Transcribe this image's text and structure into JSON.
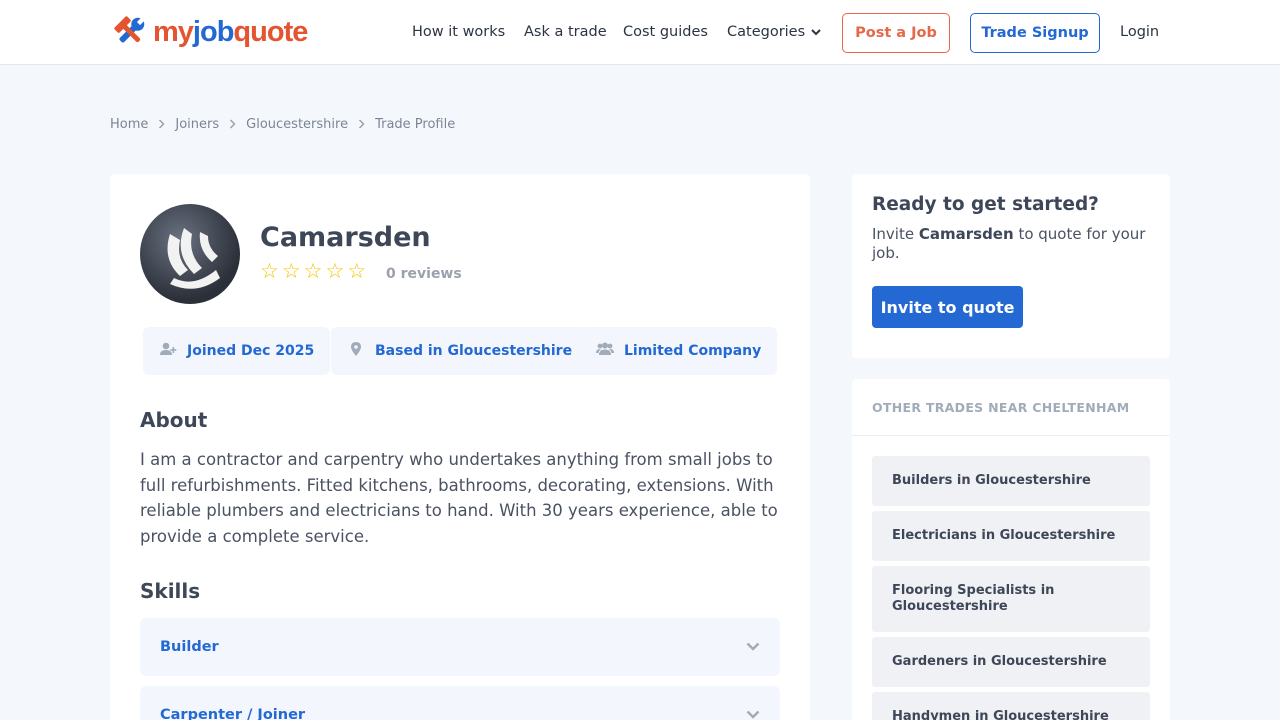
{
  "brand": {
    "logo_part1": "my",
    "logo_part2": "job",
    "logo_part3": "quote"
  },
  "nav": {
    "how_it_works": "How it works",
    "ask_a_trade": "Ask a trade",
    "cost_guides": "Cost guides",
    "categories": "Categories",
    "post_job": "Post a Job",
    "trade_signup": "Trade Signup",
    "login": "Login"
  },
  "breadcrumb": [
    "Home",
    "Joiners",
    "Gloucestershire",
    "Trade Profile"
  ],
  "profile": {
    "name": "Camarsden",
    "rating": 0,
    "rating_max": 5,
    "reviews": "0 reviews",
    "chips": {
      "joined": "Joined Dec 2025",
      "based": "Based in Gloucestershire",
      "company": "Limited Company"
    }
  },
  "about": {
    "title": "About",
    "text": "I am a contractor and carpentry who undertakes anything from small jobs to full refurbishments. Fitted kitchens, bathrooms, decorating, extensions. With reliable plumbers and electricians to hand. With 30 years experience, able to provide a complete service."
  },
  "skills": {
    "title": "Skills",
    "items": [
      "Builder",
      "Carpenter / Joiner"
    ]
  },
  "cta": {
    "title": "Ready to get started?",
    "text_prefix": "Invite ",
    "text_name": "Camarsden",
    "text_suffix": " to quote for your job.",
    "button": "Invite to quote"
  },
  "other_trades": {
    "title": "OTHER TRADES NEAR CHELTENHAM",
    "items": [
      "Builders in Gloucestershire",
      "Electricians in Gloucestershire",
      "Flooring Specialists in Gloucestershire",
      "Gardeners in Gloucestershire",
      "Handymen in Gloucestershire"
    ]
  },
  "colors": {
    "brand_blue": "#2368d3",
    "brand_orange": "#e4542f",
    "star": "#f4c400",
    "page_bg": "#f4f8fd"
  },
  "icons": [
    "tools-logo-icon",
    "chevron-down-icon",
    "chevron-right-icon",
    "star-outline-icon",
    "user-plus-icon",
    "map-pin-icon",
    "users-icon"
  ]
}
